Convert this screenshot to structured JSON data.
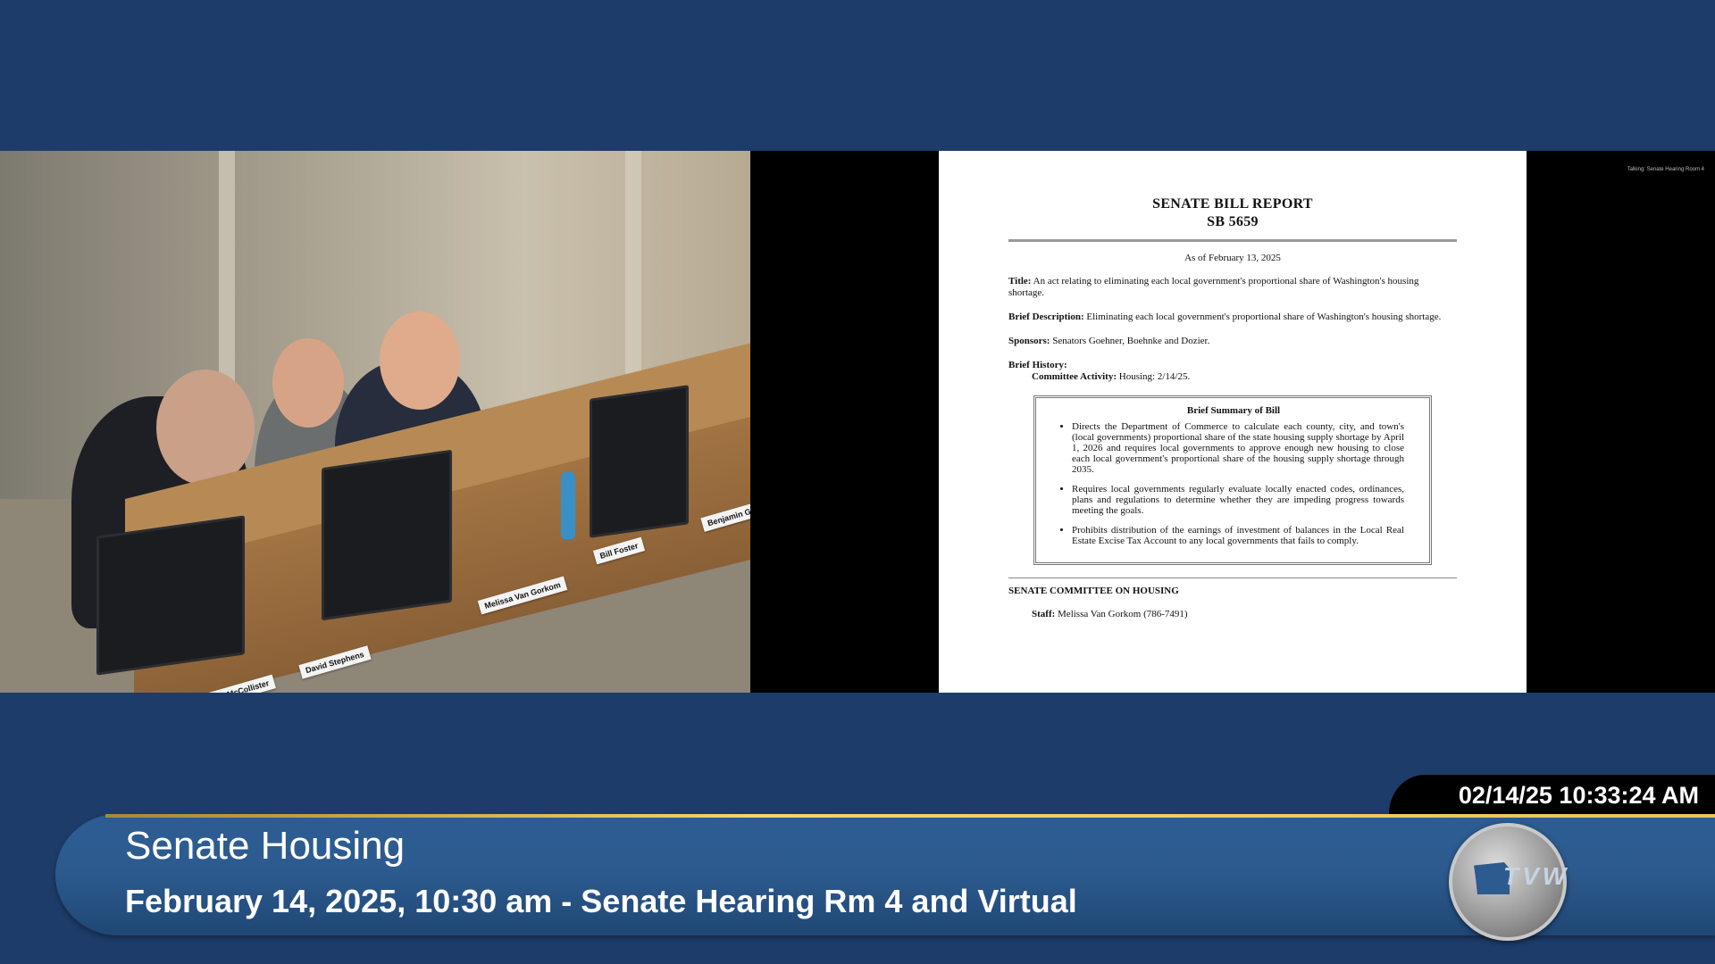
{
  "camera": {
    "nameplates": [
      "Christopher McCollister",
      "David Stephens",
      "Melissa Van Gorkom",
      "Bill Foster",
      "Benjamin Green"
    ]
  },
  "document": {
    "title": "SENATE BILL REPORT",
    "bill_number": "SB 5659",
    "as_of": "As of February 13, 2025",
    "title_label": "Title:",
    "title_text": "An act relating to eliminating each local government's proportional share of Washington's housing shortage.",
    "brief_desc_label": "Brief Description:",
    "brief_desc_text": "Eliminating each local government's proportional share of Washington's housing shortage.",
    "sponsors_label": "Sponsors:",
    "sponsors_text": "Senators Goehner, Boehnke and Dozier.",
    "history_label": "Brief History:",
    "committee_activity_label": "Committee Activity:",
    "committee_activity_text": "Housing: 2/14/25.",
    "summary_title": "Brief Summary of Bill",
    "summary_items": [
      "Directs the Department of Commerce to calculate each county, city, and town's (local governments) proportional share of the state housing supply shortage by April 1, 2026 and requires local governments to approve enough new housing to close each local government's proportional share of the housing supply shortage through 2035.",
      "Requires local governments regularly evaluate locally enacted codes, ordinances, plans and regulations to determine whether they are impeding progress towards meeting the goals.",
      "Prohibits distribution of the earnings of investment of balances in the Local Real Estate Excise Tax Account to any local governments that fails to comply."
    ],
    "committee_heading": "SENATE COMMITTEE ON HOUSING",
    "staff_label": "Staff:",
    "staff_text": "Melissa Van Gorkom (786-7491)"
  },
  "corner_text": "Talking: Senate Hearing Room 4",
  "overlay": {
    "timestamp": "02/14/25 10:33:24 AM",
    "program": "Senate Housing",
    "subtitle": "February 14, 2025, 10:30 am - Senate Hearing Rm 4 and Virtual",
    "logo_text": "TVW"
  },
  "colors": {
    "background": "#1d3c6a",
    "banner": "#2d5b8f",
    "accent_line": "#f2d46a"
  }
}
